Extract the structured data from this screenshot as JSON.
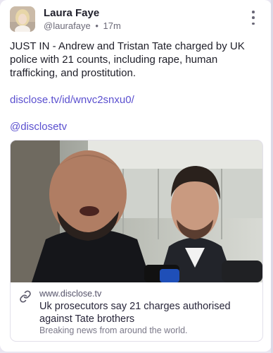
{
  "post": {
    "author_name": "Laura Faye",
    "author_handle": "@laurafaye",
    "separator": "•",
    "time": "17m",
    "text": "JUST IN - Andrew and Tristan Tate charged by UK police with 21 counts, including rape, human trafficking, and prostitution.",
    "link_url": "disclose.tv/id/wnvc2snxu0/",
    "mention": "@disclosetv"
  },
  "preview": {
    "domain": "www.disclose.tv",
    "headline": "Uk prosecutors say 21 charges authorised against Tate brothers",
    "description": "Breaking news from around the world."
  },
  "icons": {
    "menu": "more-vertical-icon",
    "link": "link-icon"
  },
  "colors": {
    "link": "#5a4fcf",
    "page_bg": "#e9e6f1",
    "card_bg": "#ffffff"
  }
}
